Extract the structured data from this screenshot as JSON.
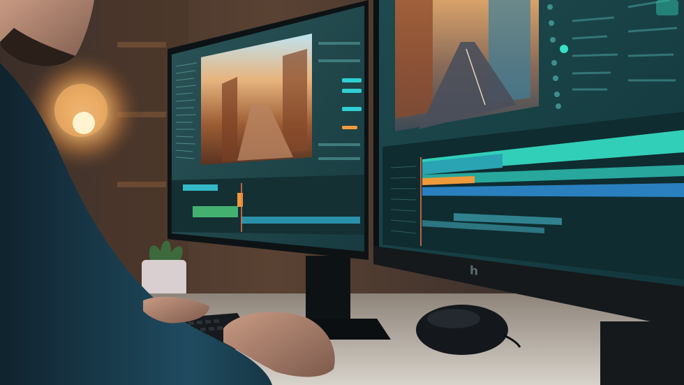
{
  "scene": {
    "description_tag": "photo",
    "colors": {
      "room_dark": "#171d22",
      "warm_glow": "#f3b56a",
      "screen_teal": "#1f7f83",
      "accent_teal": "#35e1c8",
      "accent_blue": "#2f8fd8",
      "accent_orange": "#ef9a3a",
      "bezel": "#0f1417",
      "desk": "#c9c6bf"
    }
  },
  "monitor_left": {
    "icon": "video-editor-screen"
  },
  "monitor_right": {
    "icon": "timeline-editor-screen",
    "logo": "h"
  }
}
